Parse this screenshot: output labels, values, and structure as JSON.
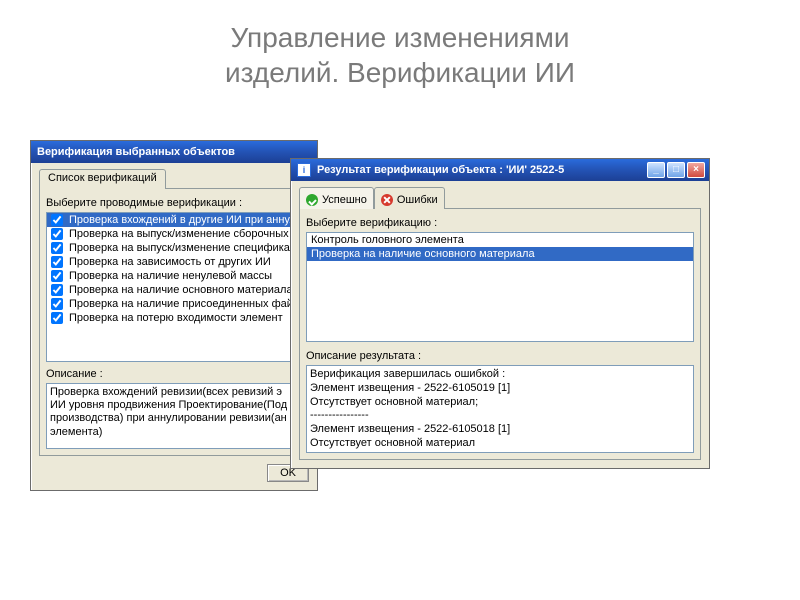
{
  "slide_title_line1": "Управление изменениями",
  "slide_title_line2": "изделий. Верификации ИИ",
  "win1": {
    "title": "Верификация выбранных объектов",
    "tab": "Список верификаций",
    "prompt": "Выберите проводимые верификации :",
    "items": [
      "Проверка вхождений в другие ИИ при аннул",
      "Проверка на выпуск/изменение сборочных",
      "Проверка на выпуск/изменение специфика",
      "Проверка на зависимость от других ИИ",
      "Проверка на наличие ненулевой массы",
      "Проверка на наличие основного материала",
      "Проверка на наличие присоединенных фай",
      "Проверка на потерю входимости элемент"
    ],
    "desc_label": "Описание :",
    "desc_text": "Проверка вхождений ревизии(всех ревизий э\nИИ уровня продвижения Проектирование(Под\nпроизводства) при аннулировании ревизии(ан\nэлемента)",
    "ok": "OK"
  },
  "win2": {
    "title": "Результат верификации объекта : 'ИИ' 2522-5",
    "tab_ok": "Успешно",
    "tab_err": "Ошибки",
    "prompt": "Выберите верификацию :",
    "list": [
      "Контроль головного элемента",
      "Проверка на наличие основного материала"
    ],
    "desc_label": "Описание результата :",
    "desc_text": "Верификация завершилась ошибкой :\nЭлемент извещения - 2522-6105019 [1]\nОтсутствует основной материал;\n----------------\nЭлемент извещения - 2522-6105018 [1]\nОтсутствует основной материал"
  }
}
